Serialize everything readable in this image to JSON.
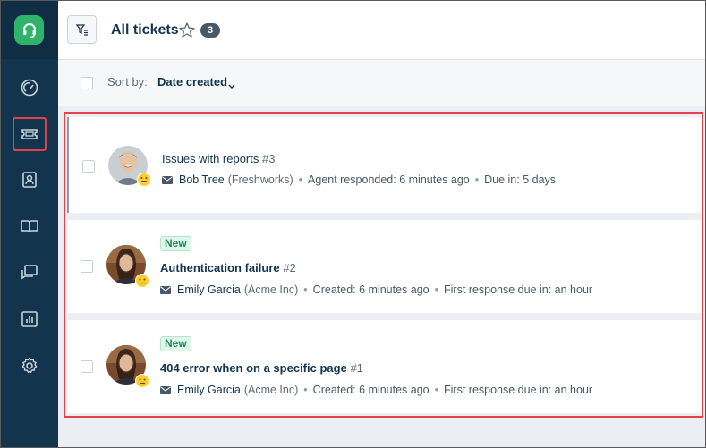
{
  "sidebar": {
    "logo": "headset-icon",
    "items": [
      {
        "name": "dashboard",
        "icon": "gauge-icon",
        "active": false
      },
      {
        "name": "tickets",
        "icon": "ticket-icon",
        "active": true
      },
      {
        "name": "contacts",
        "icon": "contact-card-icon",
        "active": false
      },
      {
        "name": "solutions",
        "icon": "book-icon",
        "active": false
      },
      {
        "name": "forums",
        "icon": "chat-icon",
        "active": false
      },
      {
        "name": "reports",
        "icon": "bar-chart-icon",
        "active": false
      },
      {
        "name": "admin",
        "icon": "gear-icon",
        "active": false
      }
    ]
  },
  "header": {
    "title": "All tickets",
    "count": "3"
  },
  "sort": {
    "label": "Sort by:",
    "value": "Date created"
  },
  "tickets": [
    {
      "badge": "",
      "subject": "Issues with reports",
      "number": "#3",
      "requester": "Bob Tree",
      "company": "(Freshworks)",
      "status": "Agent responded: 6 minutes ago",
      "due": "Due in: 5 days",
      "mood": "happy-emoji-icon"
    },
    {
      "badge": "New",
      "subject": "Authentication failure",
      "number": "#2",
      "requester": "Emily Garcia",
      "company": "(Acme Inc)",
      "status": "Created: 6 minutes ago",
      "due": "First response due in: an hour",
      "mood": "neutral-emoji-icon"
    },
    {
      "badge": "New",
      "subject": "404 error when on a specific page",
      "number": "#1",
      "requester": "Emily Garcia",
      "company": "(Acme Inc)",
      "status": "Created: 6 minutes ago",
      "due": "First response due in: an hour",
      "mood": "neutral-emoji-icon"
    }
  ],
  "colors": {
    "sidebar": "#12344d",
    "accent_green": "#2fb36b",
    "highlight_red": "#e2434b"
  }
}
